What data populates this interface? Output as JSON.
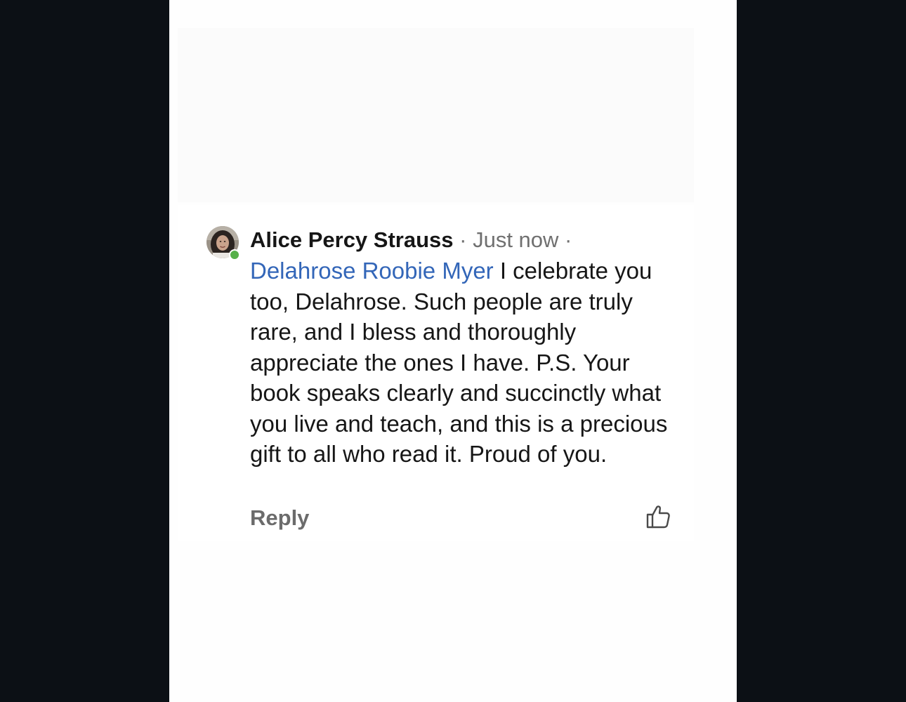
{
  "comment": {
    "author": "Alice Percy Strauss",
    "separator_1": " · ",
    "timestamp": "Just now",
    "separator_2": " ·",
    "mention": "Delahrose Roobie Myer",
    "text": " I celebrate you too, Delahrose. Such people are truly rare, and I bless and thoroughly appreciate the ones I have. P.S. Your book speaks clearly and succinctly what you live and teach, and this is a precious gift to all who read it. Proud of you.",
    "reply_label": "Reply",
    "presence_status": "online"
  },
  "colors": {
    "mention": "#3366b8",
    "presence": "#56b04a",
    "background": "#0c1015"
  },
  "icons": {
    "like": "thumbs-up-icon",
    "avatar": "avatar"
  }
}
